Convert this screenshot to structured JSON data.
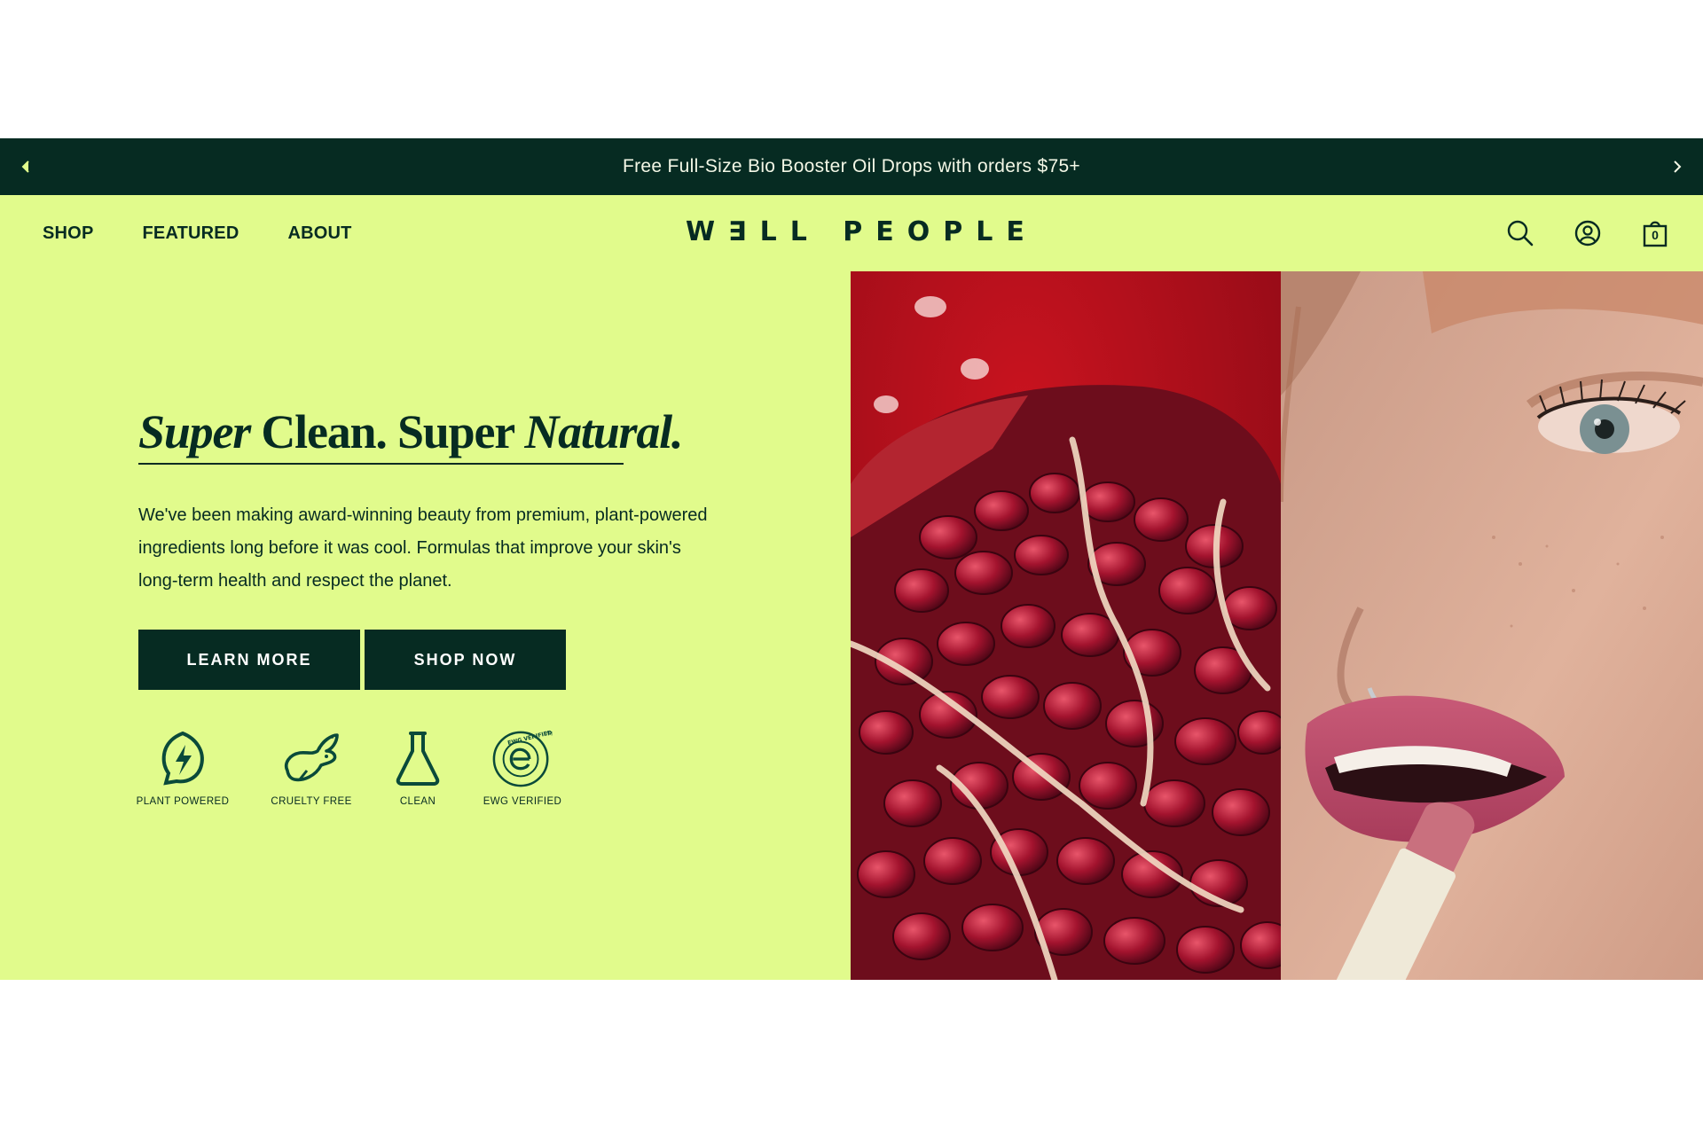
{
  "announcement": {
    "message": "Free Full-Size Bio Booster Oil Drops with orders $75+",
    "prev_icon": "chevron-left-icon",
    "next_icon": "chevron-right-icon"
  },
  "header": {
    "nav": [
      "SHOP",
      "FEATURED",
      "ABOUT"
    ],
    "logo": "W∃LL PEOPLE",
    "icons": [
      "search-icon",
      "account-icon",
      "cart-icon"
    ],
    "cart_count": "0"
  },
  "hero": {
    "headline": {
      "part1": "Super",
      "part2": " Clean. Super ",
      "part3": "Natural."
    },
    "body": "We've been making award-winning beauty from premium, plant-powered ingredients long before it was cool. Formulas that improve your skin's long-term health and respect the planet.",
    "buttons": {
      "learn_more": "LEARN MORE",
      "shop_now": "SHOP NOW"
    },
    "badges": [
      {
        "label": "PLANT POWERED",
        "icon": "leaf-bolt-icon"
      },
      {
        "label": "CRUELTY FREE",
        "icon": "rabbit-icon"
      },
      {
        "label": "CLEAN",
        "icon": "flask-icon"
      },
      {
        "label": "EWG VERIFIED",
        "icon": "ewg-verified-icon"
      }
    ]
  },
  "images": {
    "left": "pomegranate-photo",
    "right": "model-lipstick-photo"
  },
  "colors": {
    "dark_green": "#062b22",
    "lime": "#e1fb8c",
    "white": "#ffffff"
  }
}
